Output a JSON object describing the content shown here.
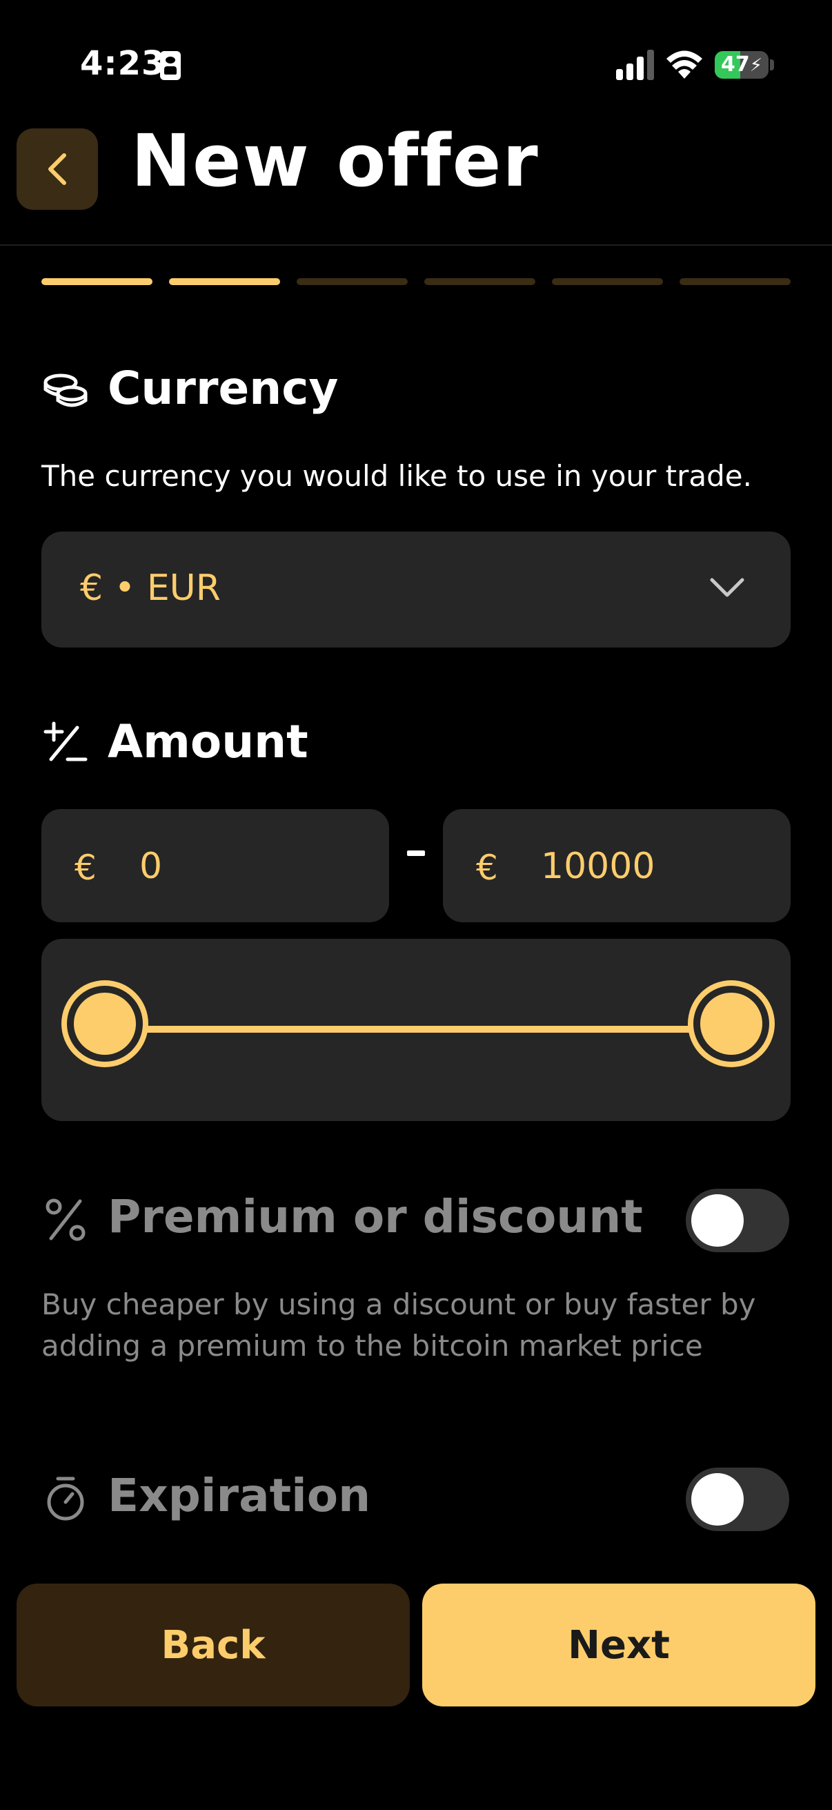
{
  "status_bar": {
    "time": "4:23",
    "battery": "47",
    "battery_level": 0.47
  },
  "header": {
    "title": "New offer"
  },
  "steps": {
    "total": 6,
    "completed": 2
  },
  "currency": {
    "title": "Currency",
    "description": "The currency you would like to use in your trade.",
    "selected": "€ • EUR"
  },
  "amount": {
    "title": "Amount",
    "currency_symbol": "€",
    "min_value": "0",
    "max_value": "10000",
    "separator": "-",
    "slider_min_fraction": 0,
    "slider_max_fraction": 1
  },
  "premium": {
    "title": "Premium or discount",
    "description": "Buy cheaper by using a discount or buy faster by adding a premium to the bitcoin market price",
    "enabled": false
  },
  "expiration": {
    "title": "Expiration",
    "enabled": false
  },
  "footer": {
    "back_label": "Back",
    "next_label": "Next"
  },
  "colors": {
    "accent": "#fdcd6c",
    "step_done": "#fdcd6c",
    "step_todo": "#3a2c15",
    "surface": "#262626",
    "background": "#000000"
  }
}
